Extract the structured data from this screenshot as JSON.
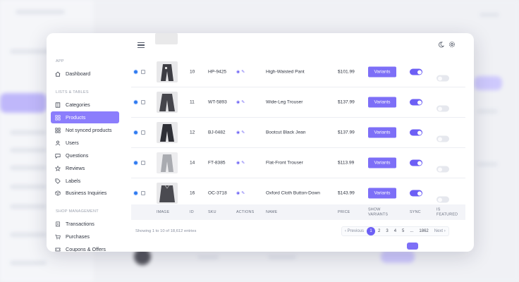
{
  "sidebar": {
    "sections": [
      {
        "label": "APP"
      },
      {
        "label": "LISTS & TABLES"
      },
      {
        "label": "SHOP MANAGEMENT"
      }
    ],
    "items": [
      {
        "label": "Dashboard",
        "icon": "home-icon"
      },
      {
        "label": "Categories",
        "icon": "book-icon"
      },
      {
        "label": "Products",
        "icon": "grid-icon",
        "active": true
      },
      {
        "label": "Not synced products",
        "icon": "grid-icon"
      },
      {
        "label": "Users",
        "icon": "user-icon"
      },
      {
        "label": "Questions",
        "icon": "chat-icon"
      },
      {
        "label": "Reviews",
        "icon": "star-icon"
      },
      {
        "label": "Labels",
        "icon": "tag-icon"
      },
      {
        "label": "Business Inquiries",
        "icon": "box-icon"
      },
      {
        "label": "Transactions",
        "icon": "receipt-icon"
      },
      {
        "label": "Purchases",
        "icon": "cart-icon"
      },
      {
        "label": "Coupons & Offers",
        "icon": "ticket-icon"
      }
    ]
  },
  "topbar": {
    "menu_icon": "hamburger-icon",
    "theme_icon": "moon-icon",
    "settings_icon": "gear-icon"
  },
  "rows": [
    {
      "id": "10",
      "sku": "HP-9425",
      "name": "High-Waisted Pant",
      "price": "$101.99",
      "variants_label": "Variants",
      "sync": true,
      "featured": false,
      "thumb": "dark"
    },
    {
      "id": "11",
      "sku": "WT-5893",
      "name": "Wide-Leg Trouser",
      "price": "$137.99",
      "variants_label": "Variants",
      "sync": true,
      "featured": false,
      "thumb": "dark"
    },
    {
      "id": "12",
      "sku": "BJ-0482",
      "name": "Bootcut Black Jean",
      "price": "$137.99",
      "variants_label": "Variants",
      "sync": true,
      "featured": false,
      "thumb": "dark"
    },
    {
      "id": "14",
      "sku": "FT-8385",
      "name": "Flat-Front Trouser",
      "price": "$113.99",
      "variants_label": "Variants",
      "sync": true,
      "featured": false,
      "thumb": "light"
    },
    {
      "id": "16",
      "sku": "OC-3718",
      "name": "Oxford Cloth Button-Down",
      "price": "$143.99",
      "variants_label": "Variants",
      "sync": true,
      "featured": false,
      "thumb": "dark"
    }
  ],
  "columns": {
    "image": "IMAGE",
    "id": "ID",
    "sku": "SKU",
    "actions": "ACTIONS",
    "name": "NAME",
    "price": "PRICE",
    "show_variants_1": "SHOW",
    "show_variants_2": "VARIANTS",
    "sync": "SYNC",
    "featured_1": "IS",
    "featured_2": "FEATURED"
  },
  "footer": {
    "showing": "Showing 1 to 10 of 18,612 entries",
    "pagination": {
      "prev": "‹ Previous",
      "pages": [
        "1",
        "2",
        "3",
        "4",
        "5",
        "...",
        "1862"
      ],
      "current": "1",
      "next": "Next ›"
    }
  },
  "colors": {
    "accent": "#7d6ff7",
    "radio": "#2f7bf0"
  }
}
